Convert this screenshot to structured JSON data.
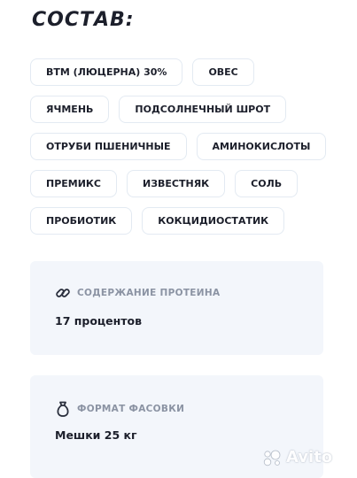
{
  "section": {
    "title": "СОСТАВ:"
  },
  "ingredients": {
    "rows": [
      [
        "ВТМ (ЛЮЦЕРНА) 30%",
        "ОВЕС"
      ],
      [
        "ЯЧМЕНЬ",
        "ПОДСОЛНЕЧНЫЙ ШРОТ"
      ],
      [
        "ОТРУБИ ПШЕНИЧНЫЕ",
        "АМИНОКИСЛОТЫ"
      ],
      [
        "ПРЕМИКС",
        "ИЗВЕСТНЯК",
        "СОЛЬ"
      ],
      [
        "ПРОБИОТИК",
        "КОКЦИДИОСТАТИК"
      ]
    ]
  },
  "protein_card": {
    "icon": "link-icon",
    "label": "СОДЕРЖАНИЕ ПРОТЕИНА",
    "value": "17 процентов"
  },
  "packaging_card": {
    "icon": "sack-icon",
    "label": "ФОРМАТ ФАСОВКИ",
    "value": "Мешки 25 кг"
  },
  "watermark": {
    "text": "Avito",
    "icon": "avito-dots-icon"
  },
  "colors": {
    "text": "#1c1f2b",
    "muted": "#8b93a3",
    "chip_border": "#e3eaf2",
    "card_bg": "#f3f6fb"
  }
}
